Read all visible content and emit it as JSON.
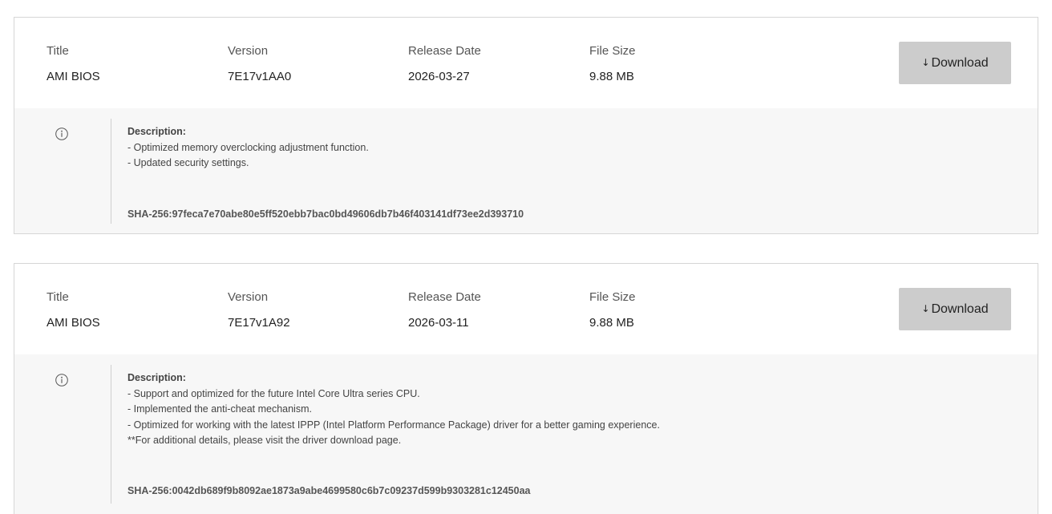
{
  "releases": [
    {
      "title_label": "Title",
      "title_value": "AMI BIOS",
      "version_label": "Version",
      "version_value": "7E17v1AA0",
      "date_label": "Release Date",
      "date_value": "2026-03-27",
      "size_label": "File Size",
      "size_value": "9.88 MB",
      "download_label": "Download",
      "description_label": "Description:",
      "description_lines": [
        "- Optimized memory overclocking adjustment function.",
        "- Updated security settings."
      ],
      "sha": "SHA-256:97feca7e70abe80e5ff520ebb7bac0bd49606db7b46f403141df73ee2d393710"
    },
    {
      "title_label": "Title",
      "title_value": "AMI BIOS",
      "version_label": "Version",
      "version_value": "7E17v1A92",
      "date_label": "Release Date",
      "date_value": "2026-03-11",
      "size_label": "File Size",
      "size_value": "9.88 MB",
      "download_label": "Download",
      "description_label": "Description:",
      "description_lines": [
        "- Support and optimized for the future Intel Core Ultra series CPU.",
        "- Implemented the anti-cheat mechanism.",
        "- Optimized for working with the latest IPPP (Intel Platform Performance Package) driver for a better gaming experience.",
        "**For additional details, please visit the driver download page."
      ],
      "sha": "SHA-256:0042db689f9b8092ae1873a9abe4699580c6b7c09237d599b9303281c12450aa"
    }
  ],
  "icons": {
    "download": "down-arrow-icon",
    "info": "info-circle-icon"
  },
  "colors": {
    "button_bg": "#cccccc",
    "detail_bg": "#f7f7f7",
    "border": "#d6d6d6"
  }
}
